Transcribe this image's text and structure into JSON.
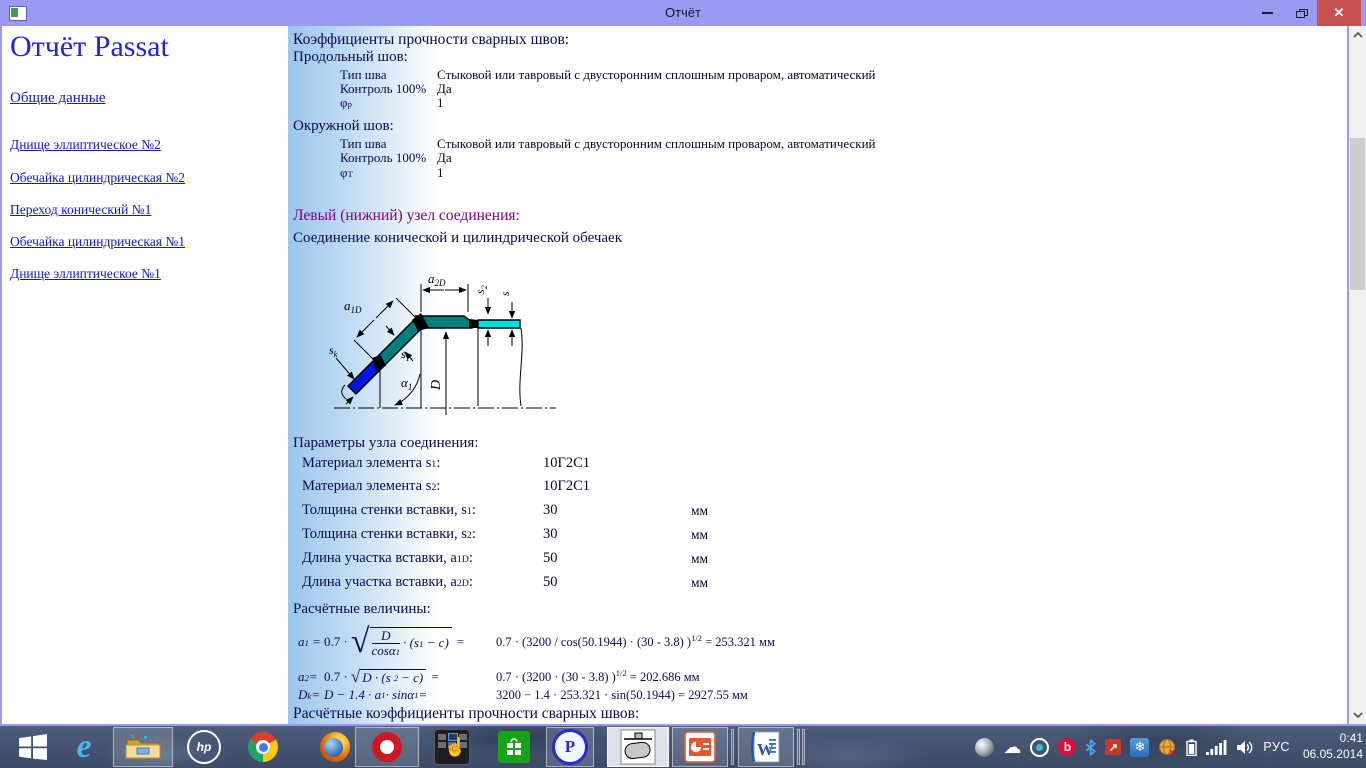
{
  "titlebar": {
    "title": "Отчёт",
    "close_glyph": "✕"
  },
  "sidebar": {
    "title": "Отчёт Passat",
    "links": [
      "Общие данные",
      "Днище эллиптическое №2",
      "Обечайка цилиндрическая №2",
      "Переход конический №1",
      "Обечайка цилиндрическая №1",
      "Днище эллиптическое №1"
    ]
  },
  "report": {
    "weld_heading": "Коэффициенты прочности сварных швов:",
    "longitudinal": {
      "title": "Продольный шов:",
      "type_label": "Тип шва",
      "type_value": "Стыковой или тавровый с двусторонним сплошным проваром, автоматический",
      "control_label": "Контроль 100%",
      "control_value": "Да",
      "phi_html": "φ<sub>р</sub>",
      "phi_value": "1"
    },
    "circumferential": {
      "title": "Окружной шов:",
      "type_label": "Тип шва",
      "type_value": "Стыковой или тавровый с двусторонним сплошным проваром, автоматический",
      "control_label": "Контроль 100%",
      "control_value": "Да",
      "phi_html": "φ<sub>Т</sub>",
      "phi_value": "1"
    },
    "node_heading": "Левый (нижний) узел соединения:",
    "node_subheading": "Соединение конической и цилиндрической обечаек",
    "diagram_labels": {
      "a1d": "a",
      "a1d_sub": "1D",
      "a2d": "a",
      "a2d_sub": "2D",
      "s2": "s",
      "s2_sub": "2",
      "s": "s",
      "sk": "s",
      "sk_sub": "k",
      "s1": "s",
      "s1_sub": "1",
      "alpha": "α",
      "alpha_sub": "1",
      "d": "D"
    },
    "params_heading": "Параметры узла соединения:",
    "params": [
      {
        "label_html": "Материал элемента s<sub>1</sub>:",
        "value": "10Г2С1",
        "unit": ""
      },
      {
        "label_html": "Материал элемента s<sub>2</sub>:",
        "value": "10Г2С1",
        "unit": ""
      },
      {
        "label_html": "Толщина стенки вставки, s<sub>1</sub>:",
        "value": "30",
        "unit": "мм"
      },
      {
        "label_html": "Толщина стенки вставки, s<sub>2</sub>:",
        "value": "30",
        "unit": "мм"
      },
      {
        "label_html": "Длина участка вставки, a<sub>1D</sub>:",
        "value": "50",
        "unit": "мм"
      },
      {
        "label_html": "Длина участка вставки, a<sub>2D</sub>:",
        "value": "50",
        "unit": "мм"
      }
    ],
    "calc_heading": "Расчётные величины:",
    "f1": {
      "lhs_html": "a<sub>1</sub> =",
      "pre": "0.7 ·",
      "num": "D",
      "den_html": "cosα<sub>1</sub>",
      "post_html": "· (s<sub>1</sub> − c)",
      "eq": "=",
      "rhs_html": "0.7 · (3200 / cos(50.1944) · (30 - 3.8)  )<sup>1/2</sup> = 253.321 мм"
    },
    "f2": {
      "lhs_html": "a<sub>2</sub>=",
      "pre": "0.7 ·",
      "rad_html": "D · (s<sub>2</sub> − c)",
      "eq": "=",
      "rhs_html": "0.7 · (3200 · (30 - 3.8)  )<sup>1/2</sup> = 202.686 мм"
    },
    "f3": {
      "lhs_html": "D<sub>k</sub>=",
      "expr_html": "D − 1.4 · a<sub>1</sub> · sinα<sub>1</sub> =",
      "rhs_html": "3200 − 1.4 · 253.321 · sin(50.1944) = 2927.55 мм"
    },
    "footer_heading": "Расчётные коэффициенты прочности сварных швов:"
  },
  "taskbar": {
    "ie_letter": "e",
    "hp_label": "hp",
    "passat_letter": "P",
    "word_letter": "W",
    "beats_letter": "b",
    "touch_hand": "☝",
    "cloud_glyph": "☁",
    "redarrow_glyph": "↗",
    "snow_glyph": "❄",
    "tray": {
      "lang": "РУС",
      "time": "0:41",
      "date": "06.05.2014"
    }
  },
  "colors": {
    "titlebar": "#9a9af2",
    "close_red": "#c75050",
    "link_blue": "#1414d2",
    "heading_purple": "#800080",
    "cone_teal": "#007d7d",
    "cone_blue": "#0018dd",
    "shell_cyan": "#00e0e0"
  }
}
